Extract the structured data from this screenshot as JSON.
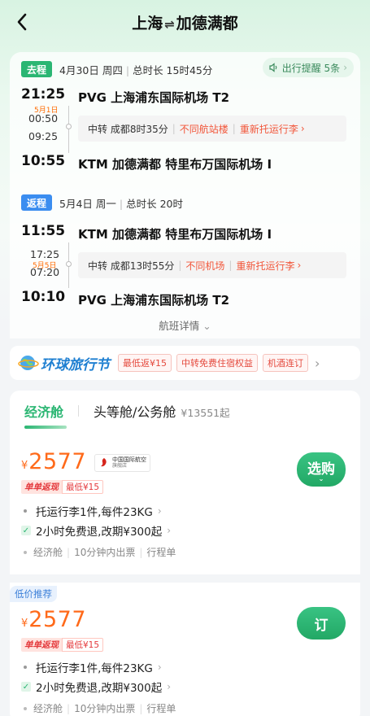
{
  "header": {
    "from": "上海",
    "arrow": "⇌",
    "to": "加德满都"
  },
  "outbound": {
    "tag": "去程",
    "date": "4月30日 周四",
    "duration": "总时长 15时45分",
    "reminder": "出行提醒 5条",
    "dep_time": "21:25",
    "arr_prev_day_label": "5月1日",
    "stop_arr_time": "00:50",
    "stop_dep_time": "09:25",
    "arr_time": "10:55",
    "dep_airport": "PVG 上海浦东国际机场 T2",
    "arr_airport": "KTM 加德满都 特里布万国际机场 I",
    "transfer_label": "中转 成都8时35分",
    "transfer_warn1": "不同航站楼",
    "transfer_warn2": "重新托运行李"
  },
  "return": {
    "tag": "返程",
    "date": "5月4日 周一",
    "duration": "总时长 20时",
    "dep_time": "11:55",
    "stop_arr_time": "17:25",
    "stop_day_label": "5月5日",
    "stop_dep_time": "07:20",
    "arr_time": "10:10",
    "dep_airport": "KTM 加德满都 特里布万国际机场 I",
    "arr_airport": "PVG 上海浦东国际机场 T2",
    "transfer_label": "中转 成都13时55分",
    "transfer_warn1": "不同机场",
    "transfer_warn2": "重新托运行李"
  },
  "flight_detail_label": "航班详情",
  "promo": {
    "title": "环球旅行节",
    "tags": [
      "最低返¥15",
      "中转免费住宿权益",
      "机酒连订"
    ]
  },
  "cabins": {
    "economy": "经济舱",
    "first": "头等舱/公务舱",
    "first_price": "¥13551起"
  },
  "offers": [
    {
      "yen": "¥",
      "price": "2577",
      "airline_cn": "中国国际航空",
      "airline_sub": "旗舰店",
      "rebate_label": "单单返现",
      "rebate_amount": "最低¥15",
      "feature1": "托运行李1件,每件23KG",
      "feature2": "2小时免费退,改期¥300起",
      "meta": [
        "经济舱",
        "10分钟内出票",
        "行程单"
      ],
      "button": "选购"
    },
    {
      "tag": "低价推荐",
      "yen": "¥",
      "price": "2577",
      "rebate_label": "单单返现",
      "rebate_amount": "最低¥15",
      "feature1": "托运行李1件,每件23KG",
      "feature2": "2小时免费退,改期¥300起",
      "meta": [
        "经济舱",
        "10分钟内出票",
        "行程单"
      ],
      "button": "订"
    }
  ],
  "colors": {
    "brand_green": "#2bb673",
    "price_orange": "#ff6a1a",
    "warn_red": "#f2563a",
    "return_blue": "#3b8df0"
  }
}
